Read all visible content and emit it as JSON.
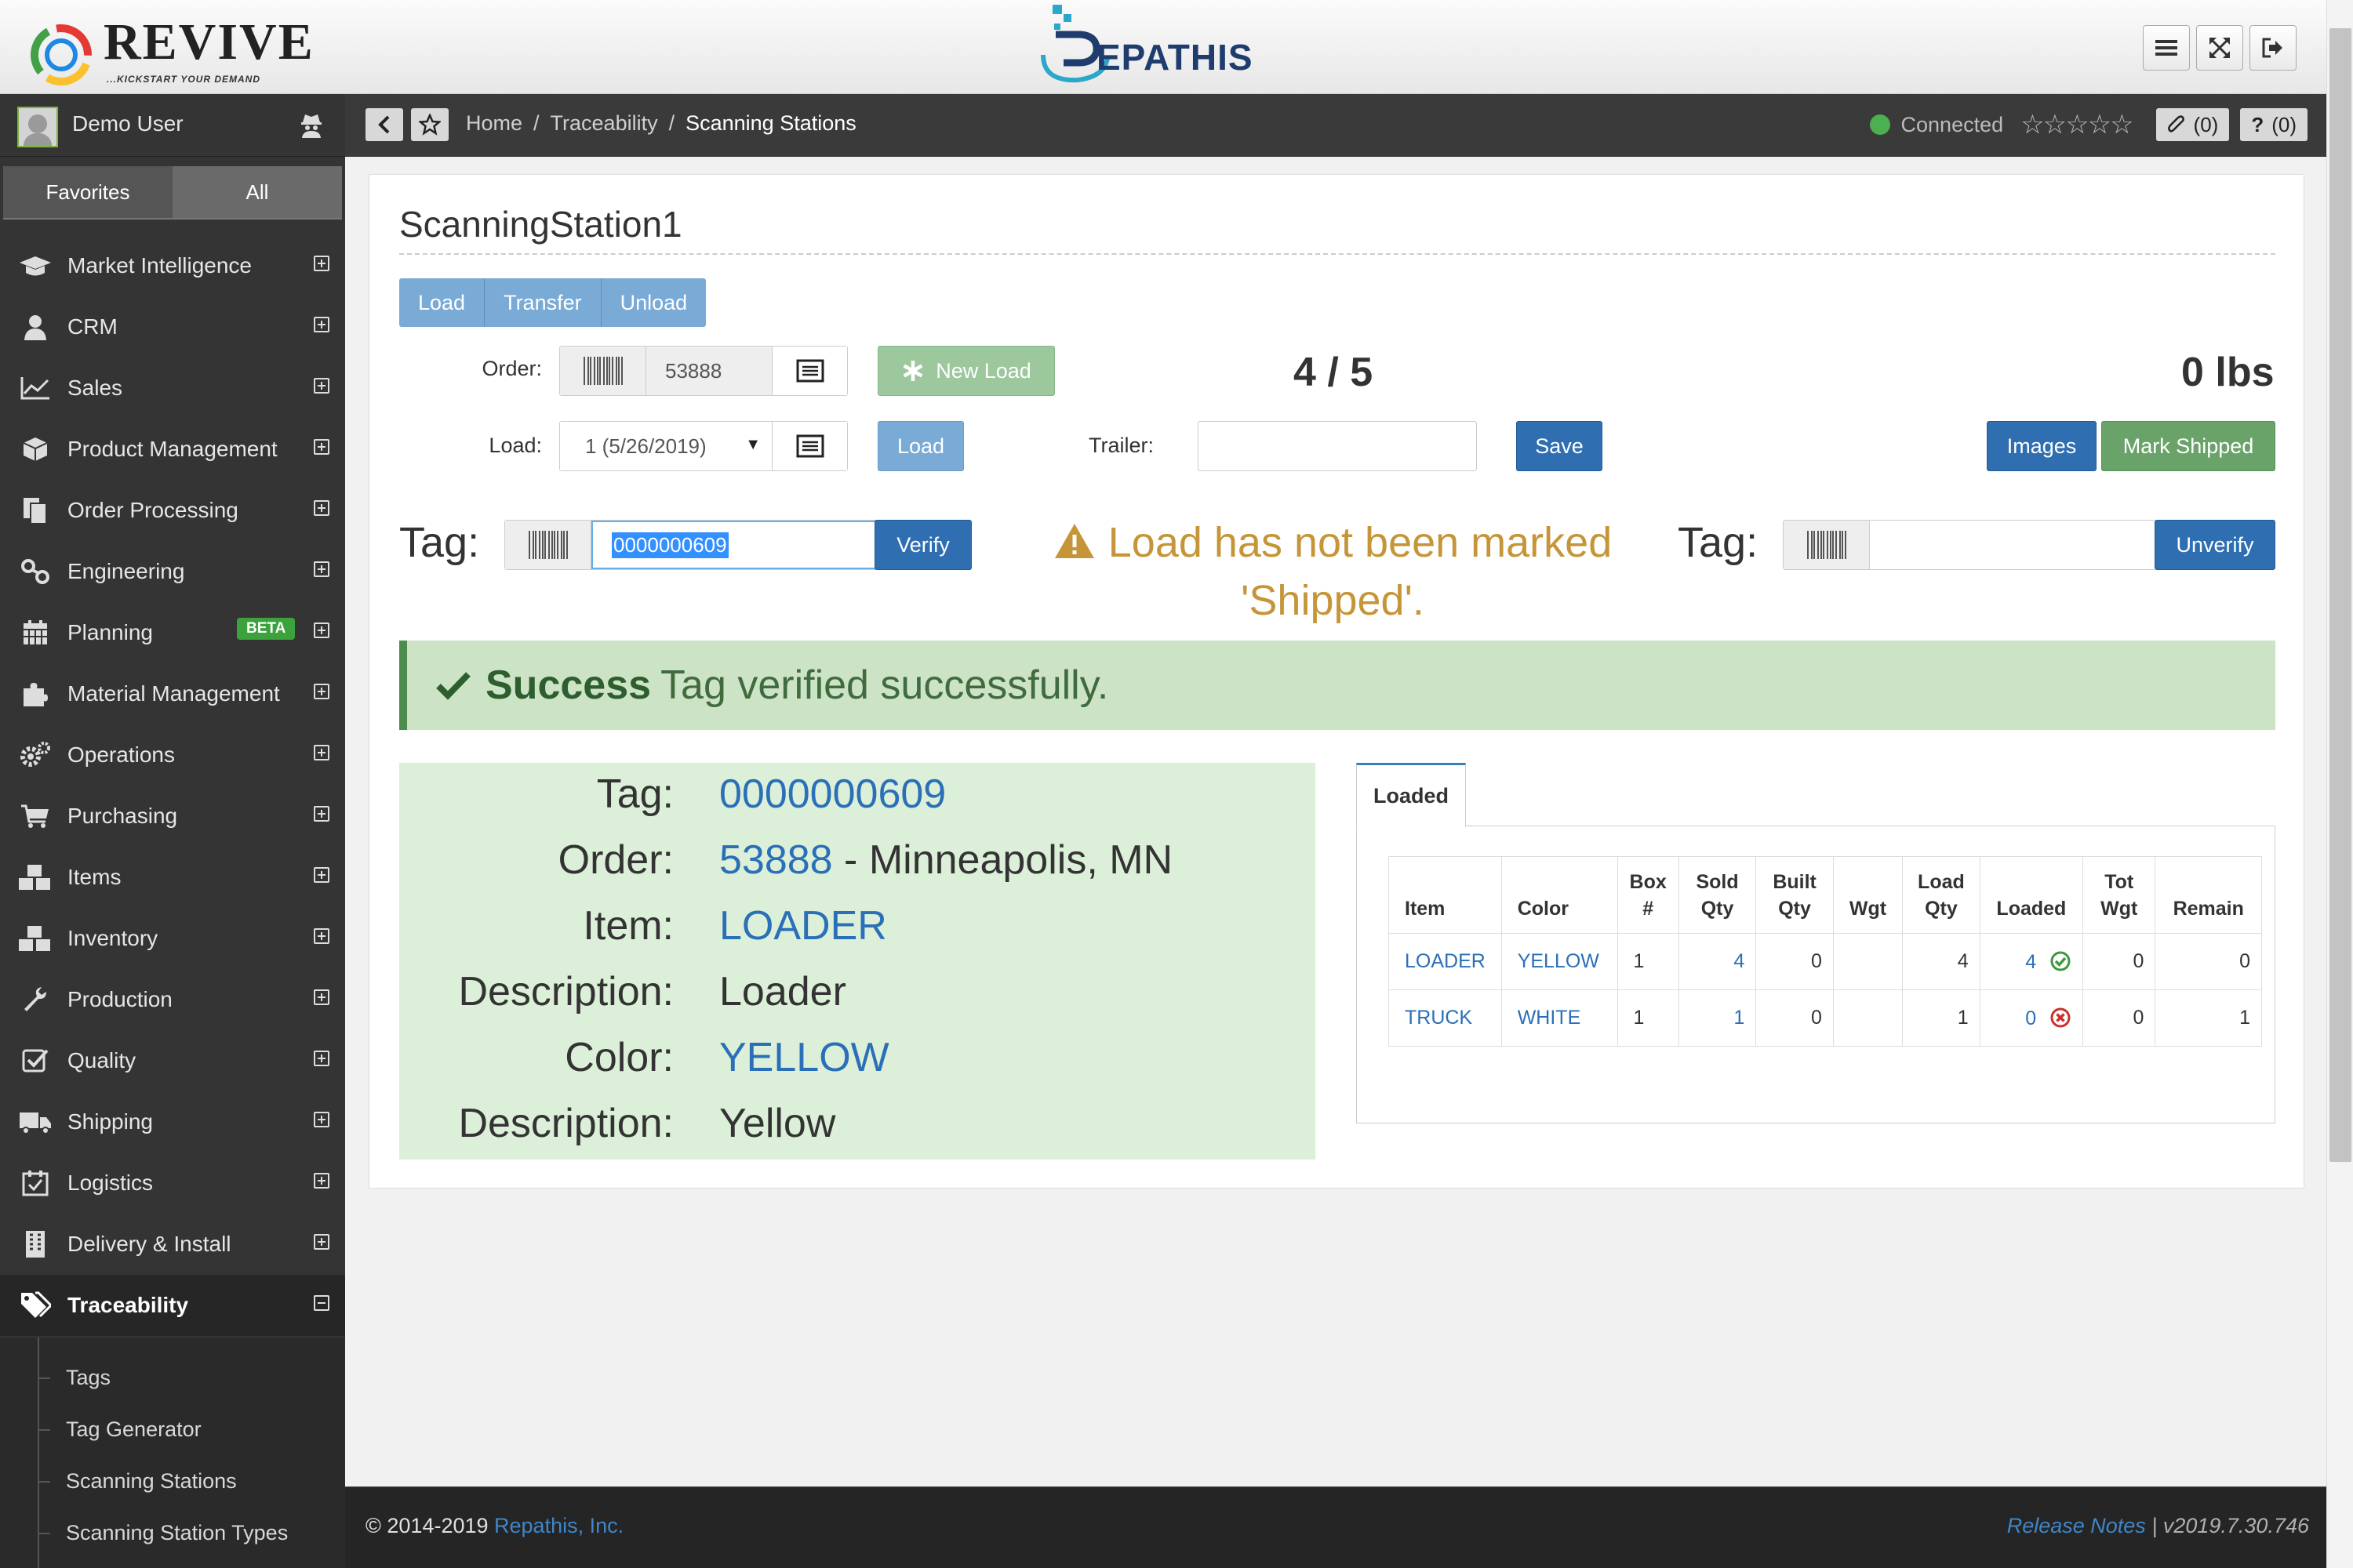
{
  "brand": {
    "left_name": "REVIVE",
    "left_tagline": "...KICKSTART YOUR DEMAND",
    "center_name": "EPATHIS"
  },
  "user": {
    "name": "Demo User"
  },
  "sidebar": {
    "tabs": [
      {
        "label": "Favorites"
      },
      {
        "label": "All"
      }
    ],
    "items": [
      {
        "label": "Market Intelligence",
        "icon": "graduation-cap-icon"
      },
      {
        "label": "CRM",
        "icon": "user-icon"
      },
      {
        "label": "Sales",
        "icon": "line-chart-icon"
      },
      {
        "label": "Product Management",
        "icon": "cube-icon"
      },
      {
        "label": "Order Processing",
        "icon": "documents-icon"
      },
      {
        "label": "Engineering",
        "icon": "flask-icon"
      },
      {
        "label": "Planning",
        "icon": "calendar-icon",
        "badge": "BETA"
      },
      {
        "label": "Material Management",
        "icon": "puzzle-icon"
      },
      {
        "label": "Operations",
        "icon": "gears-icon"
      },
      {
        "label": "Purchasing",
        "icon": "cart-icon"
      },
      {
        "label": "Items",
        "icon": "cubes-icon"
      },
      {
        "label": "Inventory",
        "icon": "cubes-icon"
      },
      {
        "label": "Production",
        "icon": "wrench-icon"
      },
      {
        "label": "Quality",
        "icon": "check-square-icon"
      },
      {
        "label": "Shipping",
        "icon": "truck-icon"
      },
      {
        "label": "Logistics",
        "icon": "calendar-check-icon"
      },
      {
        "label": "Delivery & Install",
        "icon": "building-icon"
      },
      {
        "label": "Traceability",
        "icon": "tags-icon",
        "active": true
      }
    ],
    "submenu": [
      {
        "label": "Tags"
      },
      {
        "label": "Tag Generator"
      },
      {
        "label": "Scanning Stations"
      },
      {
        "label": "Scanning Station Types"
      }
    ]
  },
  "breadcrumb": {
    "items": [
      "Home",
      "Traceability"
    ],
    "separator": "/",
    "current": "Scanning Stations"
  },
  "status": {
    "connection": "Connected",
    "stars": "☆☆☆☆☆",
    "attachments": "(0)",
    "help": "(0)"
  },
  "station": {
    "title": "ScanningStation1",
    "mode_buttons": [
      "Load",
      "Transfer",
      "Unload"
    ],
    "order_label": "Order:",
    "order_value": "53888",
    "new_load_label": "New Load",
    "count": "4 / 5",
    "weight": "0 lbs",
    "load_label": "Load:",
    "load_value": "1 (5/26/2019)",
    "load_button": "Load",
    "trailer_label": "Trailer:",
    "trailer_value": "",
    "save_label": "Save",
    "images_label": "Images",
    "mark_shipped_label": "Mark Shipped",
    "tag_label": "Tag:",
    "tag_value": "0000000609",
    "verify_label": "Verify",
    "unverify_tag_value": "",
    "unverify_label": "Unverify",
    "warning": "Load has not been marked 'Shipped'."
  },
  "alert": {
    "title": "Success",
    "message": "Tag verified successfully."
  },
  "details": {
    "tag_key": "Tag:",
    "tag_val": "0000000609",
    "order_key": "Order:",
    "order_val": "53888",
    "order_place": " - Minneapolis, MN",
    "item_key": "Item:",
    "item_val": "LOADER",
    "desc_key": "Description:",
    "desc_val": "Loader",
    "color_key": "Color:",
    "color_val": "YELLOW",
    "desc2_key": "Description:",
    "desc2_val": "Yellow"
  },
  "loaded_table": {
    "tab_label": "Loaded",
    "headers": [
      "Item",
      "Color",
      "Box #",
      "Sold Qty",
      "Built Qty",
      "Wgt",
      "Load Qty",
      "Loaded",
      "Tot Wgt",
      "Remain"
    ],
    "rows": [
      {
        "item": "LOADER",
        "color": "YELLOW",
        "box": "1",
        "sold": "4",
        "built": "0",
        "wgt": "",
        "load_qty": "4",
        "loaded": "4",
        "loaded_status": "ok",
        "tot_wgt": "0",
        "remain": "0"
      },
      {
        "item": "TRUCK",
        "color": "WHITE",
        "box": "1",
        "sold": "1",
        "built": "0",
        "wgt": "",
        "load_qty": "1",
        "loaded": "0",
        "loaded_status": "missing",
        "tot_wgt": "0",
        "remain": "1"
      }
    ]
  },
  "footer": {
    "copyright": "© 2014-2019 ",
    "company": "Repathis, Inc.",
    "release_notes": "Release Notes",
    "version": " | v2019.7.30.746"
  },
  "colors": {
    "link": "#2a6fb8",
    "success_bg": "#cde3c5",
    "warning": "#c59538",
    "primary": "#2f6eb1"
  }
}
